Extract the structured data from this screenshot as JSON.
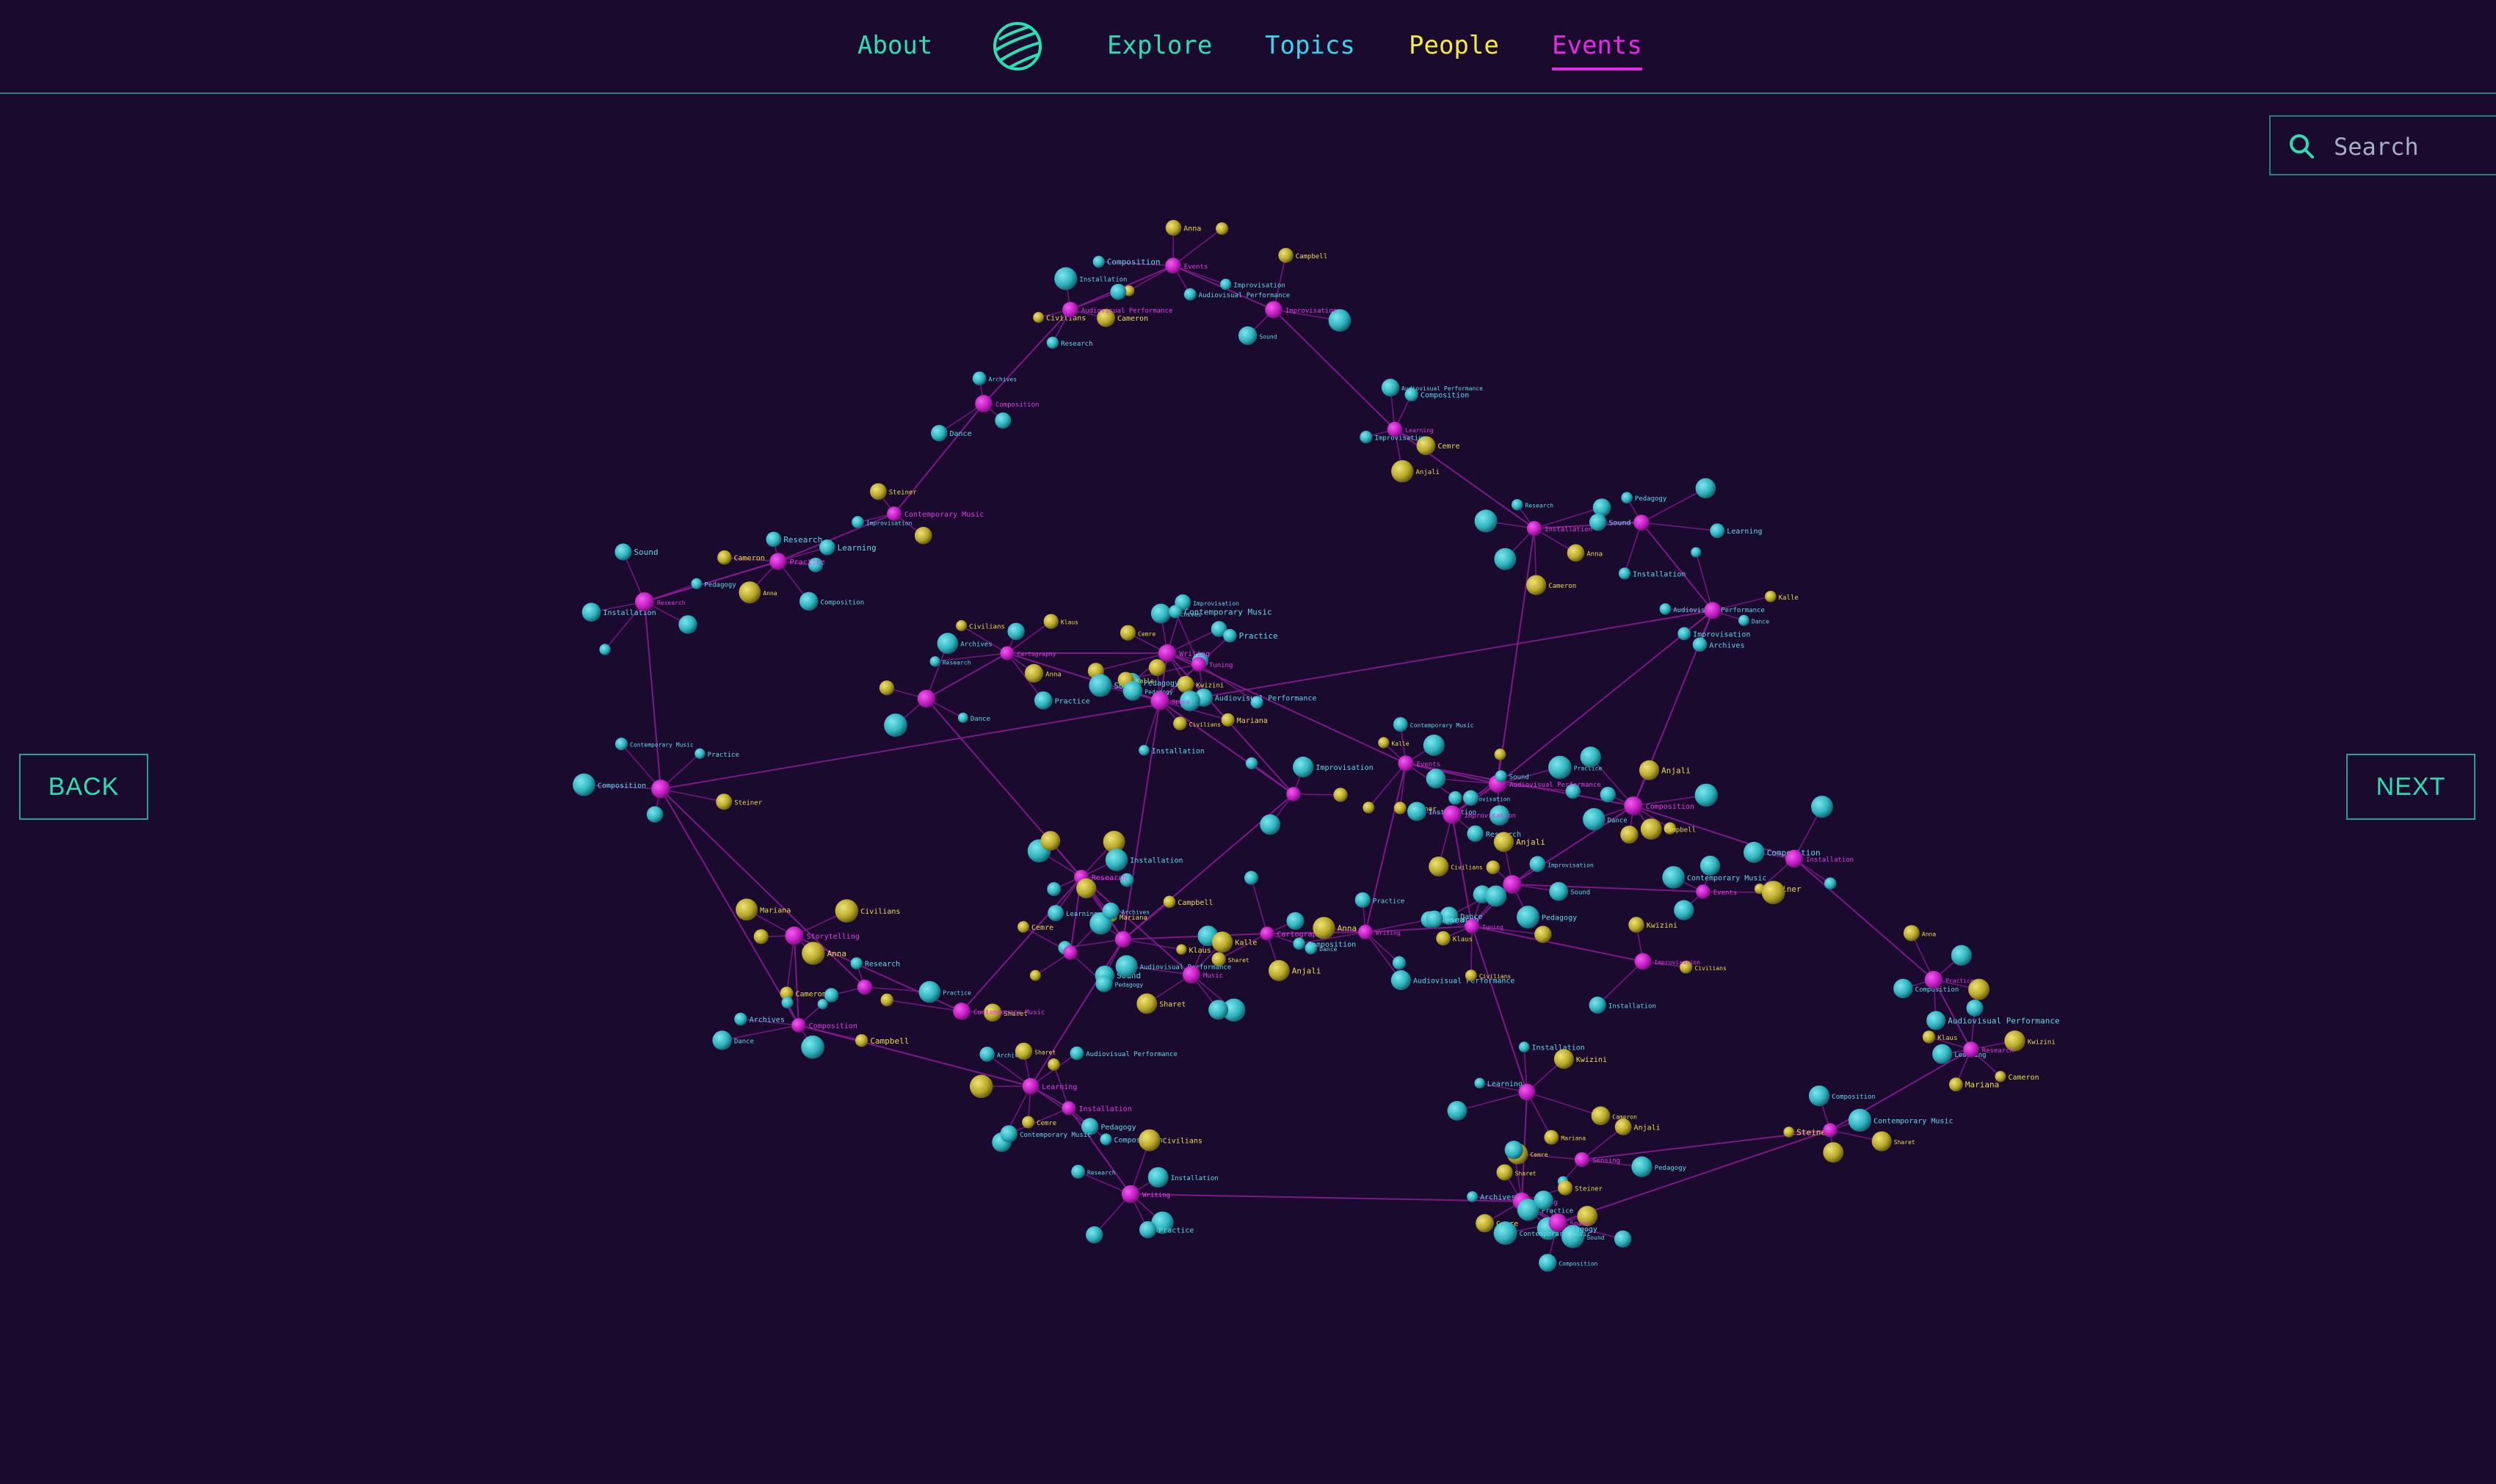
{
  "nav": {
    "about": "About",
    "explore": "Explore",
    "topics": "Topics",
    "people": "People",
    "events": "Events",
    "active": "Events"
  },
  "search": {
    "placeholder": "Search",
    "value": ""
  },
  "buttons": {
    "back": "BACK",
    "next": "NEXT"
  },
  "colors": {
    "background": "#1a0b2e",
    "event": "#c41fc4",
    "topic": "#2fb4bf",
    "person": "#b8a92a",
    "edge": "#9a1ea3",
    "accent": "#29e0b4"
  },
  "graph_labels": {
    "events": [
      "Events",
      "Audiovisual Performance",
      "Improvisation",
      "Composition",
      "Contemporary Music",
      "Practice",
      "Research",
      "Learning",
      "Installation",
      "Storytelling",
      "Sensing",
      "Cartography",
      "Writing",
      "Tuning",
      "Space",
      "Music"
    ],
    "topics": [
      "Improvisation",
      "Audiovisual Performance",
      "Composition",
      "Contemporary Music",
      "Practice",
      "Research",
      "Learning",
      "Installation",
      "Sound",
      "Pedagogy",
      "Dance",
      "Archives"
    ],
    "people": [
      "Sharet",
      "Steiner",
      "Kalle",
      "Anna",
      "Cameron",
      "Mariana",
      "Civilians",
      "Klaus",
      "Kwizini",
      "Campbell",
      "Cemre",
      "Anjali"
    ]
  }
}
